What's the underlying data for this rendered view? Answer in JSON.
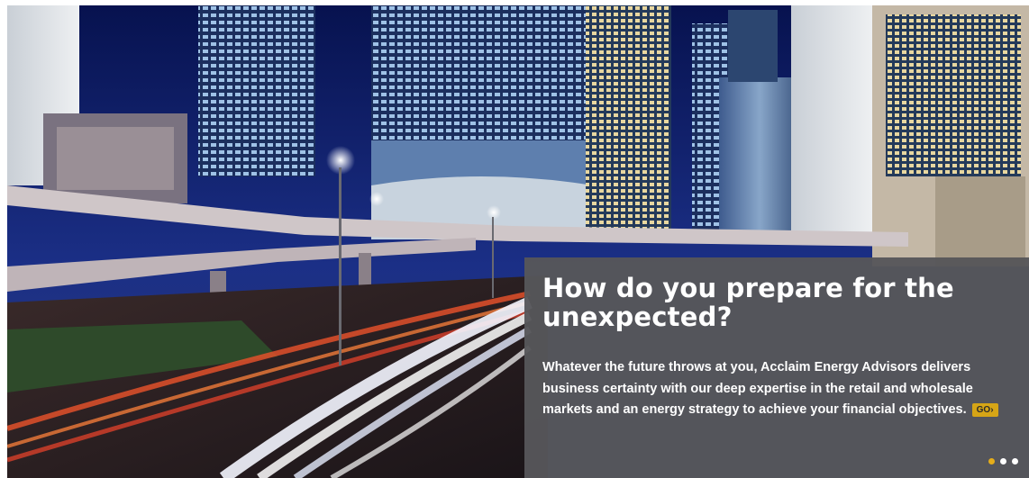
{
  "hero": {
    "image_desc": "city-night-highway-icon",
    "headline": "How do you prepare for the unexpected?",
    "body": "Whatever the future throws at you, Acclaim Energy Advisors delivers business certainty with our deep expertise in the retail and wholesale markets and an energy strategy to achieve your financial objectives.",
    "cta_label": "GO›",
    "slides": {
      "count": 3,
      "active_index": 0
    },
    "colors": {
      "panel": "#56565a",
      "accent": "#d6a516",
      "sky": "#0b1446"
    }
  }
}
